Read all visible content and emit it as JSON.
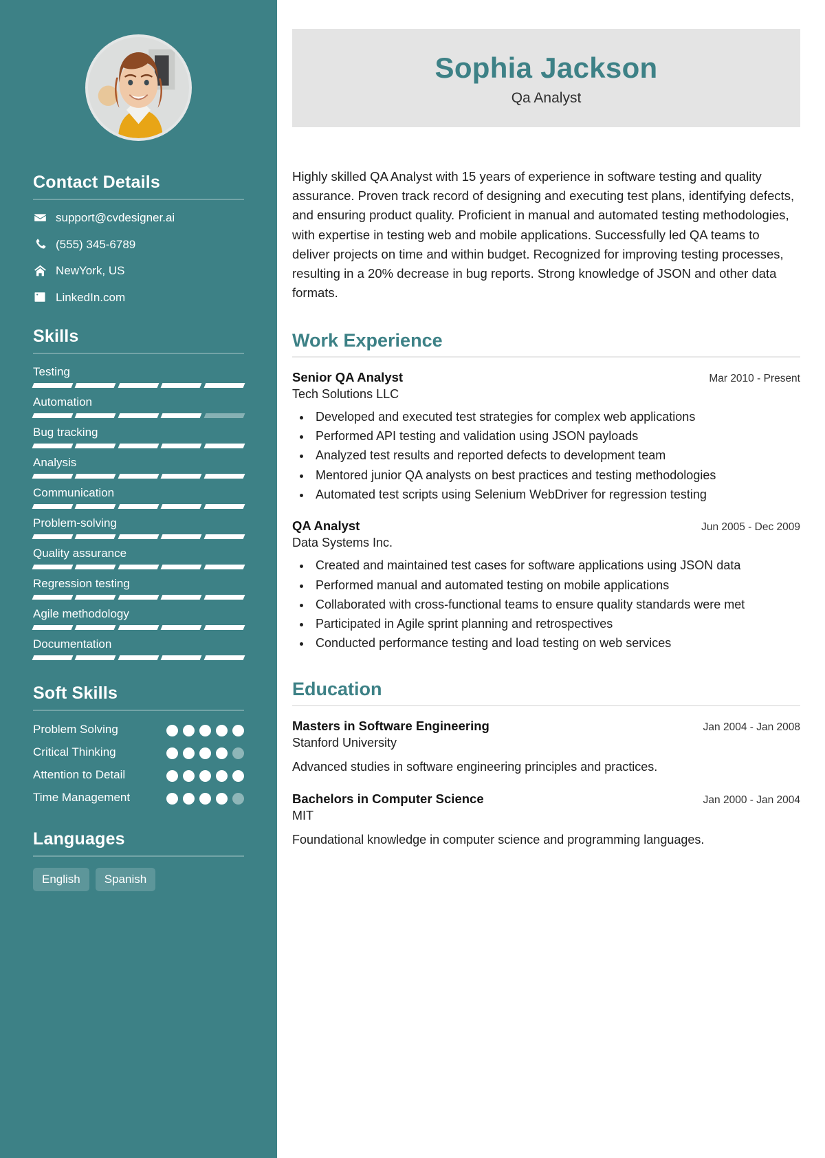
{
  "sidebar": {
    "avatar_alt": "profile-photo",
    "contact": {
      "heading": "Contact Details",
      "items": [
        {
          "icon": "envelope-icon",
          "text": "support@cvdesigner.ai"
        },
        {
          "icon": "phone-icon",
          "text": "(555) 345-6789"
        },
        {
          "icon": "home-icon",
          "text": "NewYork, US"
        },
        {
          "icon": "linkedin-icon",
          "text": "LinkedIn.com"
        }
      ]
    },
    "skills": {
      "heading": "Skills",
      "max": 5,
      "items": [
        {
          "name": "Testing",
          "level": 5
        },
        {
          "name": "Automation",
          "level": 4
        },
        {
          "name": "Bug tracking",
          "level": 5
        },
        {
          "name": "Analysis",
          "level": 5
        },
        {
          "name": "Communication",
          "level": 5
        },
        {
          "name": "Problem-solving",
          "level": 5
        },
        {
          "name": "Quality assurance",
          "level": 5
        },
        {
          "name": "Regression testing",
          "level": 5
        },
        {
          "name": "Agile methodology",
          "level": 5
        },
        {
          "name": "Documentation",
          "level": 5
        }
      ]
    },
    "soft_skills": {
      "heading": "Soft Skills",
      "max": 5,
      "items": [
        {
          "name": "Problem Solving",
          "level": 5
        },
        {
          "name": "Critical Thinking",
          "level": 4
        },
        {
          "name": "Attention to Detail",
          "level": 5
        },
        {
          "name": "Time Management",
          "level": 4
        }
      ]
    },
    "languages": {
      "heading": "Languages",
      "items": [
        "English",
        "Spanish"
      ]
    }
  },
  "main": {
    "name": "Sophia Jackson",
    "title": "Qa Analyst",
    "summary": "Highly skilled QA Analyst with 15 years of experience in software testing and quality assurance. Proven track record of designing and executing test plans, identifying defects, and ensuring product quality. Proficient in manual and automated testing methodologies, with expertise in testing web and mobile applications. Successfully led QA teams to deliver projects on time and within budget. Recognized for improving testing processes, resulting in a 20% decrease in bug reports. Strong knowledge of JSON and other data formats.",
    "work": {
      "heading": "Work Experience",
      "entries": [
        {
          "title": "Senior QA Analyst",
          "org": "Tech Solutions LLC",
          "date": "Mar 2010 - Present",
          "bullets": [
            "Developed and executed test strategies for complex web applications",
            "Performed API testing and validation using JSON payloads",
            "Analyzed test results and reported defects to development team",
            "Mentored junior QA analysts on best practices and testing methodologies",
            "Automated test scripts using Selenium WebDriver for regression testing"
          ]
        },
        {
          "title": "QA Analyst",
          "org": "Data Systems Inc.",
          "date": "Jun 2005 - Dec 2009",
          "bullets": [
            "Created and maintained test cases for software applications using JSON data",
            "Performed manual and automated testing on mobile applications",
            "Collaborated with cross-functional teams to ensure quality standards were met",
            "Participated in Agile sprint planning and retrospectives",
            "Conducted performance testing and load testing on web services"
          ]
        }
      ]
    },
    "education": {
      "heading": "Education",
      "entries": [
        {
          "title": "Masters in Software Engineering",
          "org": "Stanford University",
          "date": "Jan 2004 - Jan 2008",
          "desc": "Advanced studies in software engineering principles and practices."
        },
        {
          "title": "Bachelors in Computer Science",
          "org": "MIT",
          "date": "Jan 2000 - Jan 2004",
          "desc": "Foundational knowledge in computer science and programming languages."
        }
      ]
    }
  },
  "colors": {
    "sidebar_bg": "#3d8186",
    "accent": "#3d8186",
    "banner_bg": "#e4e4e4",
    "rule": "#e8e8e8"
  }
}
